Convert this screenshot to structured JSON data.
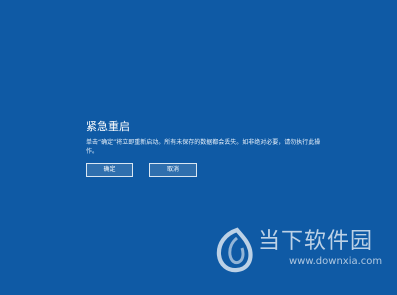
{
  "dialog": {
    "title": "紧急重启",
    "message": "单击“确定”将立即重新启动。所有未保存的数据都会丢失。如非绝对必要，请勿执行此操作。",
    "ok_label": "确定",
    "cancel_label": "取消"
  },
  "watermark": {
    "brand": "当下软件园",
    "url": "www.downxia.com"
  },
  "colors": {
    "background": "#0f5aa5",
    "button_border": "#d9e6f2",
    "button_fill": "#2f6fae",
    "text": "#ffffff"
  },
  "icons": {
    "watermark_logo": "downxia-logo-icon"
  }
}
